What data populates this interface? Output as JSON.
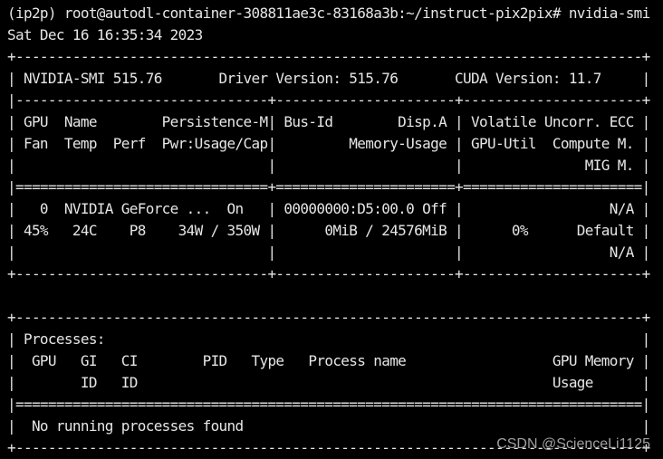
{
  "terminal": {
    "prompt": "(ip2p) root@autodl-container-308811ae3c-83168a3b:~/instruct-pix2pix# nvidia-smi",
    "date": "Sat Dec 16 16:35:34 2023",
    "lines": [
      "+-----------------------------------------------------------------------------+",
      "| NVIDIA-SMI 515.76       Driver Version: 515.76       CUDA Version: 11.7     |",
      "|-------------------------------+----------------------+----------------------+",
      "| GPU  Name        Persistence-M| Bus-Id        Disp.A | Volatile Uncorr. ECC |",
      "| Fan  Temp  Perf  Pwr:Usage/Cap|         Memory-Usage | GPU-Util  Compute M. |",
      "|                               |                      |               MIG M. |",
      "|===============================+======================+======================|",
      "|   0  NVIDIA GeForce ...  On   | 00000000:D5:00.0 Off |                  N/A |",
      "| 45%   24C    P8    34W / 350W |      0MiB / 24576MiB |      0%      Default |",
      "|                               |                      |                  N/A |",
      "+-------------------------------+----------------------+----------------------+",
      "",
      "+-----------------------------------------------------------------------------+",
      "| Processes:                                                                  |",
      "|  GPU   GI   CI        PID   Type   Process name                  GPU Memory |",
      "|        ID   ID                                                   Usage      |",
      "|=============================================================================|",
      "|  No running processes found                                                 |",
      "+-----------------------------------------------------------------------------+"
    ]
  },
  "watermark": "CSDN @ScienceLi1125"
}
